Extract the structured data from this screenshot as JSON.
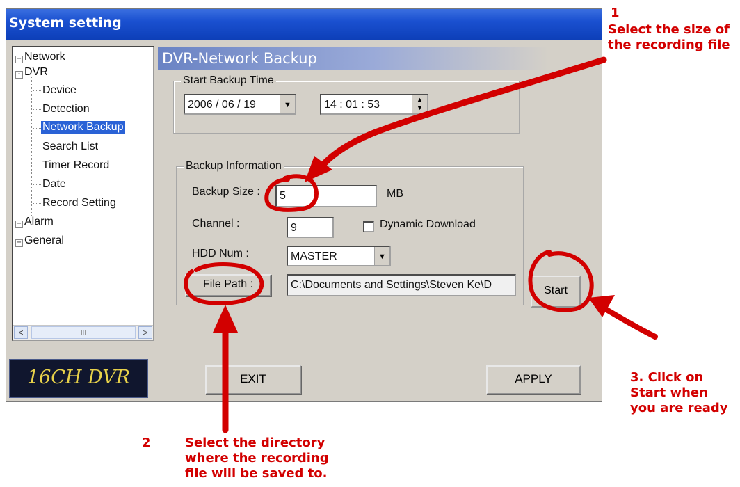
{
  "window": {
    "title": "System setting"
  },
  "tree": {
    "nodes": [
      {
        "label": "Network",
        "toggle": "+"
      },
      {
        "label": "DVR",
        "toggle": "-"
      },
      {
        "label": "Device"
      },
      {
        "label": "Detection"
      },
      {
        "label": "Network Backup",
        "selected": true
      },
      {
        "label": "Search List"
      },
      {
        "label": "Timer Record"
      },
      {
        "label": "Date"
      },
      {
        "label": "Record Setting"
      },
      {
        "label": "Alarm",
        "toggle": "+"
      },
      {
        "label": "General",
        "toggle": "+"
      }
    ],
    "scrollbar": {
      "thumb_glyph": "III",
      "left": "<",
      "right": ">"
    }
  },
  "logo": {
    "text": "16CH DVR"
  },
  "section": {
    "title": "DVR-Network Backup"
  },
  "start_backup": {
    "legend": "Start Backup Time",
    "date": "2006 / 06 / 19",
    "time": "14 : 01 : 53"
  },
  "backup_info": {
    "legend": "Backup Information",
    "size_label": "Backup Size :",
    "size_value": "5",
    "size_unit": "MB",
    "channel_label": "Channel :",
    "channel_value": "9",
    "dynamic_download_label": "Dynamic Download",
    "dynamic_download_checked": false,
    "hdd_label": "HDD Num :",
    "hdd_value": "MASTER",
    "file_path_button": "File Path :",
    "file_path_value": "C:\\Documents and Settings\\Steven Ke\\D"
  },
  "buttons": {
    "start": "Start",
    "exit": "EXIT",
    "apply": "APPLY"
  },
  "annotations": {
    "a1_number": "1",
    "a1_line1": "Select the size of",
    "a1_line2": "the recording file",
    "a2_number": "2",
    "a2_line1": "Select the directory",
    "a2_line2": "where the recording",
    "a2_line3": "file will be saved to.",
    "a3_line1": "3. Click on",
    "a3_line2": "Start when",
    "a3_line3": "you are ready",
    "color": "#d20000"
  },
  "colors": {
    "titlebar": "#1a50d0",
    "selection": "#2a62d6",
    "dialog_bg": "#d4d0c8",
    "logo_text": "#e8d24a"
  }
}
